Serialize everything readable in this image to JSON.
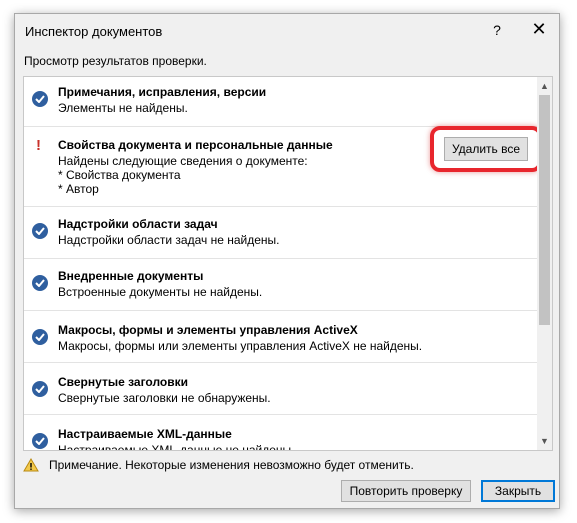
{
  "window": {
    "title": "Инспектор документов",
    "help_label": "?",
    "close_label": "✕"
  },
  "subtitle": "Просмотр результатов проверки.",
  "items": [
    {
      "status": "ok",
      "title": "Примечания, исправления, версии",
      "desc": [
        "Элементы не найдены."
      ]
    },
    {
      "status": "warning",
      "title": "Свойства документа и персональные данные",
      "desc": [
        "Найдены следующие сведения о документе:",
        "* Свойства документа",
        "* Автор"
      ],
      "button": "Удалить все"
    },
    {
      "status": "ok",
      "title": "Надстройки области задач",
      "desc": [
        "Надстройки области задач не найдены."
      ]
    },
    {
      "status": "ok",
      "title": "Внедренные документы",
      "desc": [
        "Встроенные документы не найдены."
      ]
    },
    {
      "status": "ok",
      "title": "Макросы, формы и элементы управления ActiveX",
      "desc": [
        "Макросы, формы или элементы управления ActiveX не найдены."
      ]
    },
    {
      "status": "ok",
      "title": "Свернутые заголовки",
      "desc": [
        "Свернутые заголовки не обнаружены."
      ]
    },
    {
      "status": "ok",
      "title": "Настраиваемые XML-данные",
      "desc": [
        "Настраиваемые XML-данные не найдены."
      ]
    }
  ],
  "note": "Примечание. Некоторые изменения невозможно будет отменить.",
  "buttons": {
    "recheck": "Повторить проверку",
    "close": "Закрыть"
  },
  "colors": {
    "ok_icon": "#2f5f9f",
    "warning": "#c8312a",
    "highlight": "#e8262d",
    "default_button_border": "#0078d7"
  }
}
